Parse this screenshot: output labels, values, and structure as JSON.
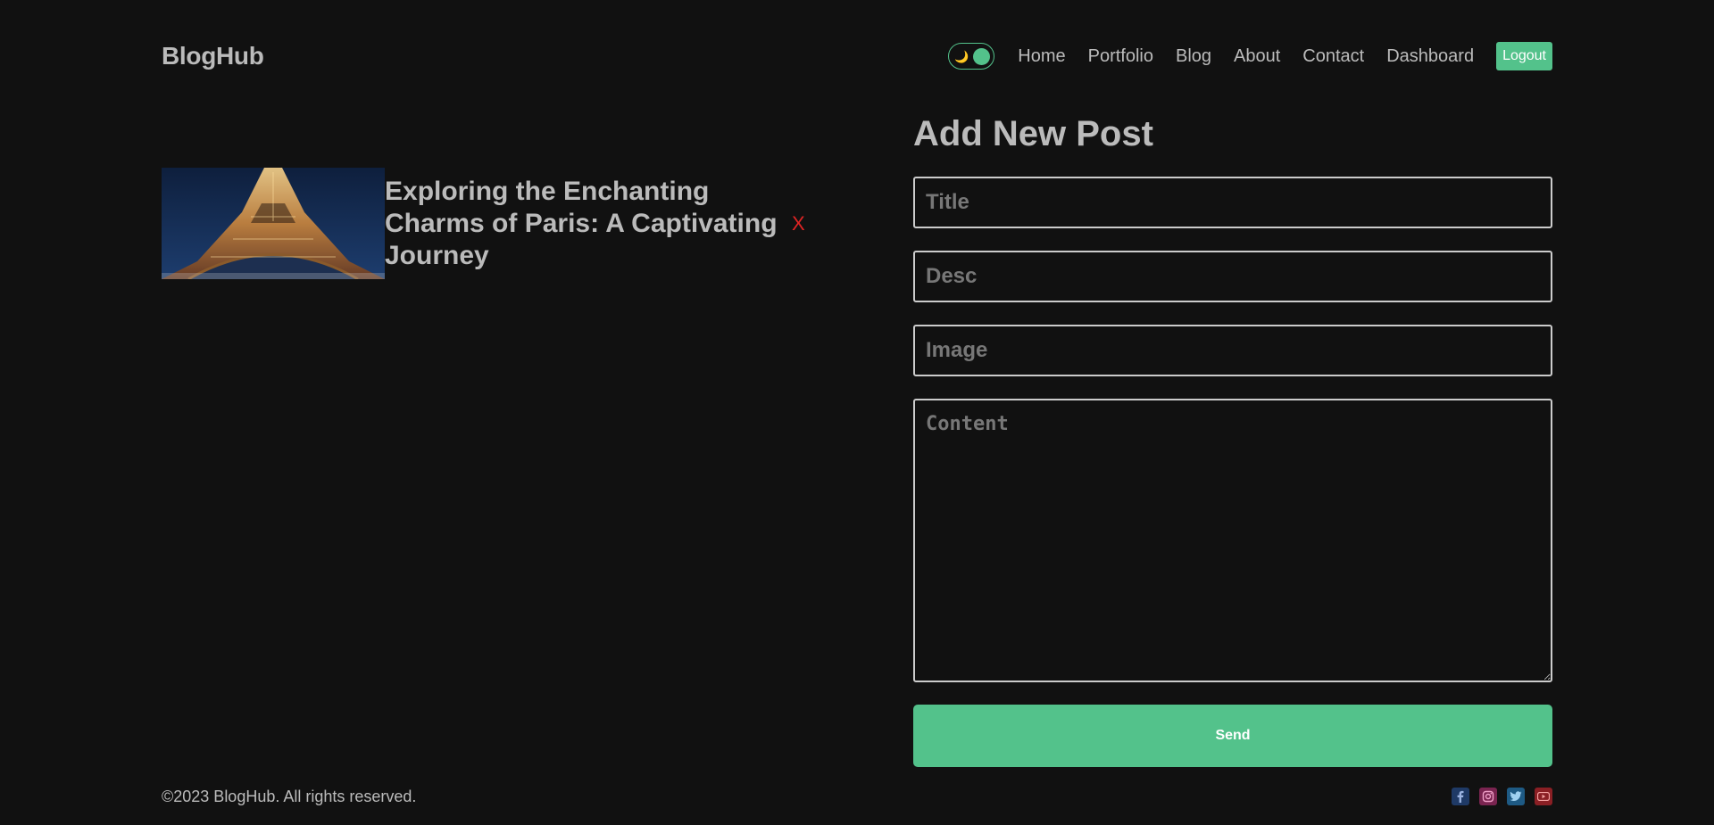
{
  "brand": "BlogHub",
  "nav": {
    "theme_toggle_icon": "moon-icon",
    "links": [
      "Home",
      "Portfolio",
      "Blog",
      "About",
      "Contact",
      "Dashboard"
    ],
    "logout_label": "Logout"
  },
  "posts": [
    {
      "title": "Exploring the Enchanting Charms of Paris: A Captivating Journey",
      "image": "eiffel-tower-night-photo",
      "delete_label": "X"
    }
  ],
  "form": {
    "heading": "Add New Post",
    "title_placeholder": "Title",
    "desc_placeholder": "Desc",
    "image_placeholder": "Image",
    "content_placeholder": "Content",
    "send_label": "Send"
  },
  "footer": {
    "copyright": "©2023 BlogHub. All rights reserved.",
    "socials": [
      "facebook-icon",
      "instagram-icon",
      "twitter-icon",
      "youtube-icon"
    ]
  },
  "colors": {
    "background": "#111111",
    "text": "#bbbbbb",
    "accent": "#53c28b",
    "danger": "#e02424"
  }
}
